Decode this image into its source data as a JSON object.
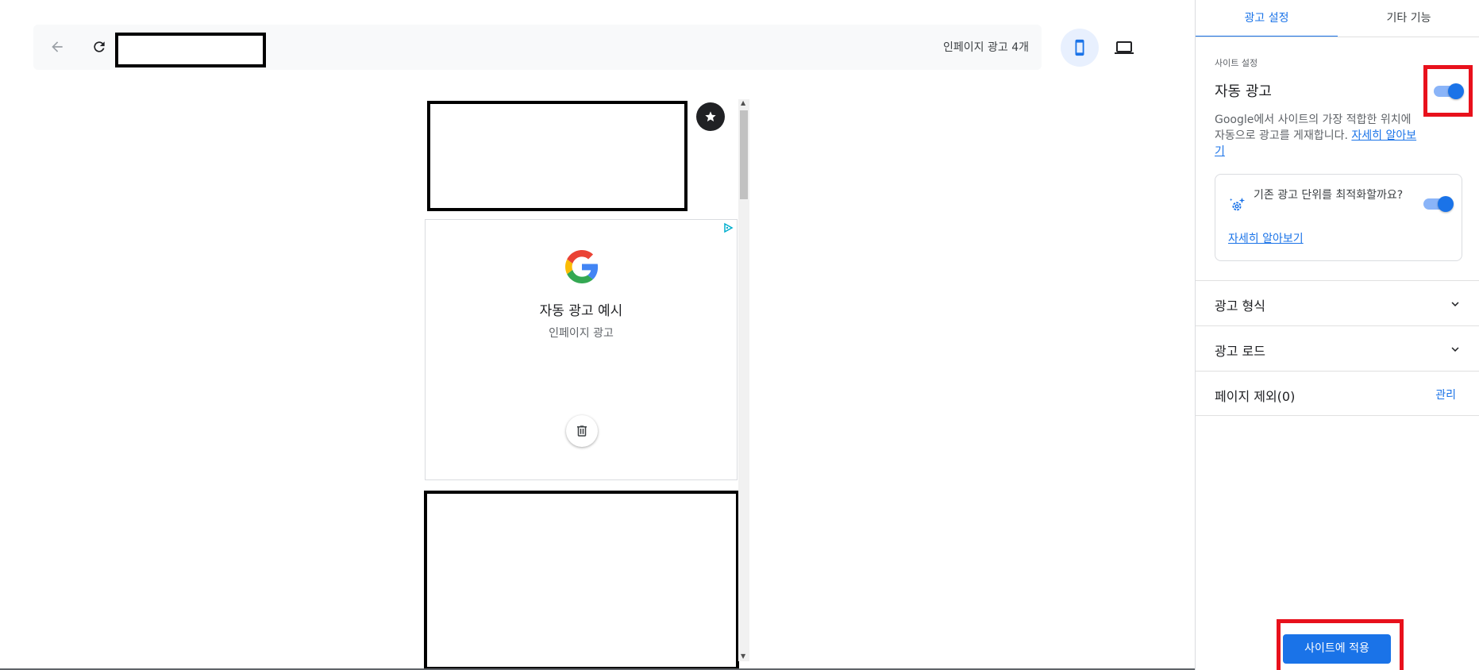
{
  "toolbar": {
    "back_icon": "arrow-left-icon",
    "reload_icon": "refresh-icon",
    "ad_count_text": "인페이지 광고 4개",
    "mobile_icon": "smartphone-icon",
    "desktop_icon": "laptop-icon"
  },
  "preview": {
    "star_icon": "star-icon",
    "ad_card": {
      "adchoices_icon": "adchoices-icon",
      "logo": "google-g-logo",
      "title": "자동 광고 예시",
      "subtitle": "인페이지 광고",
      "delete_icon": "trash-icon"
    }
  },
  "panel": {
    "tabs": [
      {
        "label": "광고 설정",
        "active": true
      },
      {
        "label": "기타 기능",
        "active": false
      }
    ],
    "site_settings_label": "사이트 설정",
    "auto_ads": {
      "title": "자동 광고",
      "enabled": true,
      "description": "Google에서 사이트의 가장 적합한 위치에 자동으로 광고를 게재합니다. ",
      "learn_more": "자세히 알아보기"
    },
    "optimize_card": {
      "icon": "sparkle-gear-icon",
      "text": "기존 광고 단위를 최적화할까요?",
      "enabled": true,
      "learn_more": "자세히 알아보기"
    },
    "rows": {
      "ad_formats": "광고 형식",
      "ad_load": "광고 로드",
      "page_exclusions": "페이지 제외(0)",
      "manage": "관리"
    },
    "apply_button": "사이트에 적용"
  },
  "colors": {
    "accent": "#1a73e8",
    "highlight": "#e8111c",
    "toggle_track": "#8ab4f8"
  }
}
